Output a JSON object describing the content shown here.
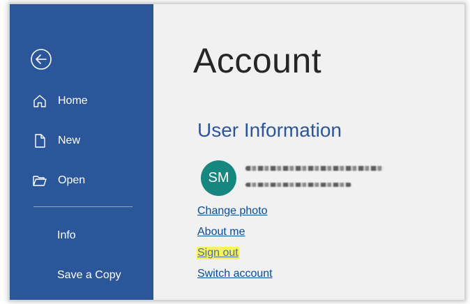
{
  "sidebar": {
    "back_icon": "arrow-left-circle-icon",
    "items": [
      {
        "label": "Home",
        "icon": "home-icon"
      },
      {
        "label": "New",
        "icon": "new-document-icon"
      },
      {
        "label": "Open",
        "icon": "open-folder-icon"
      },
      {
        "label": "Info"
      },
      {
        "label": "Save a Copy"
      }
    ],
    "background_color": "#2b579a"
  },
  "main": {
    "title": "Account",
    "section_title": "User Information",
    "avatar_initials": "SM",
    "avatar_color": "#16877f",
    "links": [
      {
        "label": "Change photo"
      },
      {
        "label": "About me"
      },
      {
        "label": "Sign out",
        "highlighted": true,
        "highlight_color": "#f6f35a"
      },
      {
        "label": "Switch account"
      }
    ]
  }
}
